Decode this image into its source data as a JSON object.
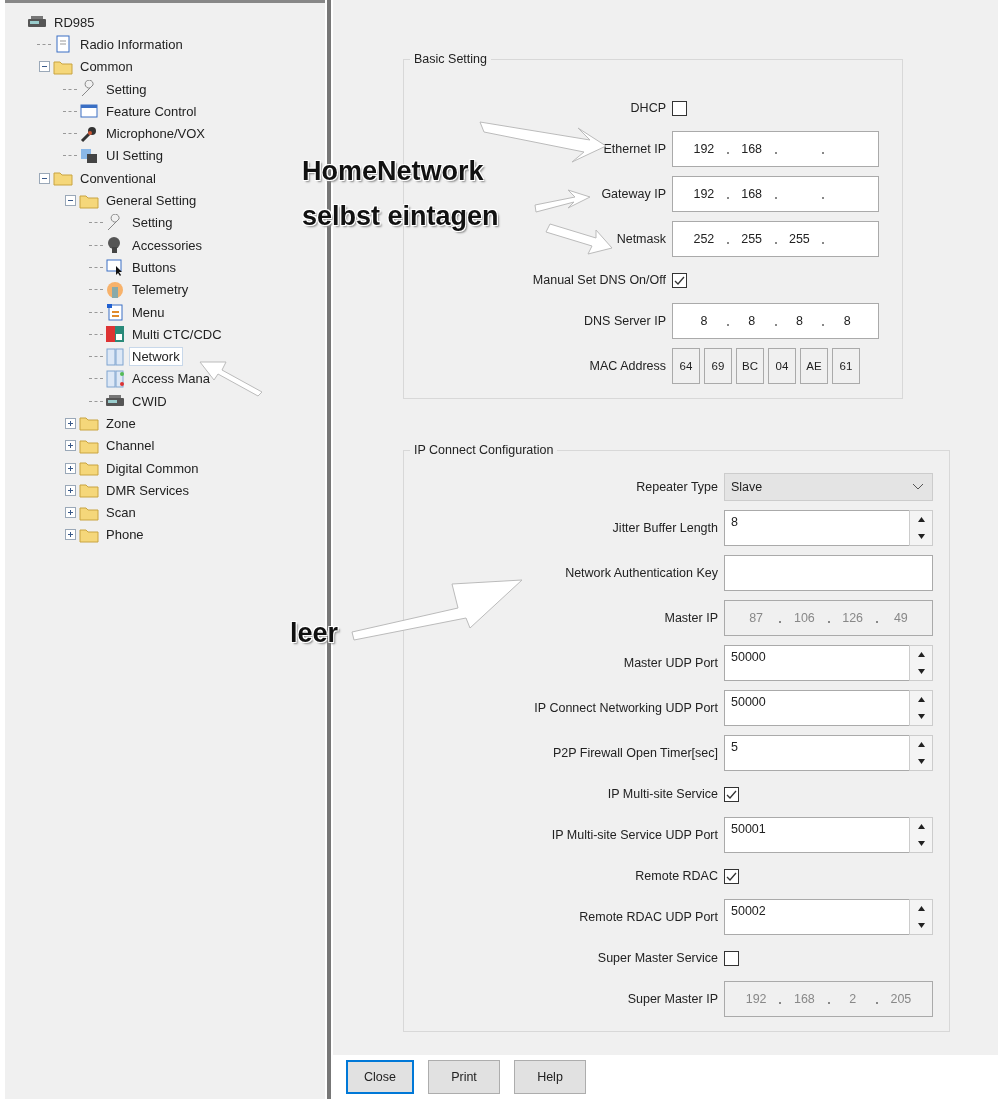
{
  "tree": {
    "label": "RD985",
    "kind": "radio",
    "selected": false,
    "children": [
      {
        "label": "Radio Information",
        "kind": "document",
        "selected": false
      },
      {
        "label": "Common",
        "kind": "folder",
        "expanded": true,
        "selected": false,
        "children": [
          {
            "label": "Setting",
            "kind": "wrench",
            "selected": false
          },
          {
            "label": "Feature Control",
            "kind": "window",
            "selected": false
          },
          {
            "label": "Microphone/VOX",
            "kind": "microphone",
            "selected": false
          },
          {
            "label": "UI Setting",
            "kind": "monitor",
            "selected": false
          }
        ]
      },
      {
        "label": "Conventional",
        "kind": "folder",
        "expanded": true,
        "selected": false,
        "children": [
          {
            "label": "General Setting",
            "kind": "folder",
            "expanded": true,
            "selected": false,
            "children": [
              {
                "label": "Setting",
                "kind": "wrench",
                "selected": false
              },
              {
                "label": "Accessories",
                "kind": "speaker",
                "selected": false
              },
              {
                "label": "Buttons",
                "kind": "cursor",
                "selected": false
              },
              {
                "label": "Telemetry",
                "kind": "telemetry",
                "selected": false
              },
              {
                "label": "Menu",
                "kind": "list",
                "selected": false
              },
              {
                "label": "Multi CTC/CDC",
                "kind": "tone",
                "selected": false
              },
              {
                "label": "Network",
                "kind": "network",
                "selected": true
              },
              {
                "label": "Access Mana",
                "kind": "access",
                "selected": false
              },
              {
                "label": "CWID",
                "kind": "radio",
                "selected": false
              }
            ]
          },
          {
            "label": "Zone",
            "kind": "folder",
            "expanded": false,
            "selected": false
          },
          {
            "label": "Channel",
            "kind": "folder",
            "expanded": false,
            "selected": false
          },
          {
            "label": "Digital Common",
            "kind": "folder",
            "expanded": false,
            "selected": false
          },
          {
            "label": "DMR Services",
            "kind": "folder",
            "expanded": false,
            "selected": false
          },
          {
            "label": "Scan",
            "kind": "folder",
            "expanded": false,
            "selected": false
          },
          {
            "label": "Phone",
            "kind": "folder",
            "expanded": false,
            "selected": false
          }
        ]
      }
    ]
  },
  "groups": [
    {
      "title": "Basic Setting",
      "kind": "basic",
      "rows": [
        {
          "label": "DHCP",
          "kind": "checkbox",
          "checked": false
        },
        {
          "label": "Ethernet IP",
          "kind": "ip",
          "disabled": false,
          "octets": [
            "192",
            "168"
          ]
        },
        {
          "label": "Gateway IP",
          "kind": "ip",
          "disabled": false,
          "octets": [
            "192",
            "168"
          ]
        },
        {
          "label": "Netmask",
          "kind": "ip",
          "disabled": false,
          "octets": [
            "252",
            "255",
            "255"
          ]
        },
        {
          "label": "Manual Set DNS On/Off",
          "kind": "checkbox",
          "checked": true
        },
        {
          "label": "DNS Server IP",
          "kind": "ip",
          "disabled": false,
          "octets": [
            "8",
            "8",
            "8",
            "8"
          ]
        },
        {
          "label": "MAC Address",
          "kind": "mac",
          "bytes": [
            "64",
            "69",
            "BC",
            "04",
            "AE",
            "61"
          ]
        }
      ]
    },
    {
      "title": "IP Connect Configuration",
      "kind": "ipconnect",
      "rows": [
        {
          "label": "Repeater Type",
          "kind": "select",
          "value": "Slave"
        },
        {
          "label": "Jitter Buffer Length",
          "kind": "spin",
          "value": "8"
        },
        {
          "label": "Network Authentication Key",
          "kind": "text"
        },
        {
          "label": "Master IP",
          "kind": "ip",
          "disabled": true,
          "octets": [
            "87",
            "106",
            "126",
            "49"
          ]
        },
        {
          "label": "Master UDP Port",
          "kind": "spin",
          "value": "50000"
        },
        {
          "label": "IP Connect Networking UDP Port",
          "kind": "spin",
          "value": "50000"
        },
        {
          "label": "P2P Firewall Open Timer[sec]",
          "kind": "spin",
          "value": "5"
        },
        {
          "label": "IP Multi-site Service",
          "kind": "checkbox",
          "checked": true
        },
        {
          "label": "IP Multi-site Service UDP Port",
          "kind": "spin",
          "value": "50001"
        },
        {
          "label": "Remote RDAC",
          "kind": "checkbox",
          "checked": true
        },
        {
          "label": "Remote RDAC UDP Port",
          "kind": "spin",
          "value": "50002"
        },
        {
          "label": "Super Master Service",
          "kind": "checkbox",
          "checked": false
        },
        {
          "label": "Super Master IP",
          "kind": "ip",
          "disabled": true,
          "octets": [
            "192",
            "168",
            "2",
            "205"
          ]
        }
      ]
    }
  ],
  "buttons": [
    {
      "label": "Close",
      "focused": true
    },
    {
      "label": "Print",
      "focused": false
    },
    {
      "label": "Help",
      "focused": false
    }
  ],
  "notes": {
    "home_network": [
      "HomeNetwork",
      "selbst eintagen"
    ],
    "empty": "leer"
  }
}
